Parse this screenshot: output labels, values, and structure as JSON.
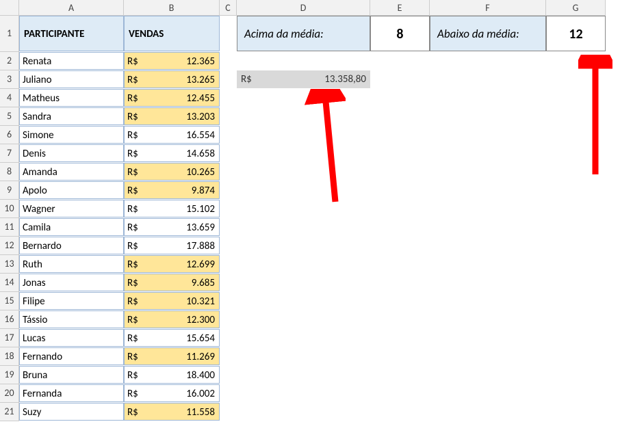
{
  "columns": [
    "A",
    "B",
    "C",
    "D",
    "E",
    "F",
    "G"
  ],
  "rowCount": 21,
  "headers": {
    "participante": "PARTICIPANTE",
    "vendas": "VENDAS"
  },
  "currencyPrefix": "R$",
  "data": [
    {
      "name": "Renata",
      "value": "12.365",
      "highlight": true
    },
    {
      "name": "Juliano",
      "value": "13.265",
      "highlight": true
    },
    {
      "name": "Matheus",
      "value": "12.455",
      "highlight": true
    },
    {
      "name": "Sandra",
      "value": "13.203",
      "highlight": true
    },
    {
      "name": "Simone",
      "value": "16.554",
      "highlight": false
    },
    {
      "name": "Denis",
      "value": "14.658",
      "highlight": false
    },
    {
      "name": "Amanda",
      "value": "10.265",
      "highlight": true
    },
    {
      "name": "Apolo",
      "value": "9.874",
      "highlight": true
    },
    {
      "name": "Wagner",
      "value": "15.102",
      "highlight": false
    },
    {
      "name": "Camila",
      "value": "13.659",
      "highlight": false
    },
    {
      "name": "Bernardo",
      "value": "17.888",
      "highlight": false
    },
    {
      "name": "Ruth",
      "value": "12.699",
      "highlight": true
    },
    {
      "name": "Jonas",
      "value": "9.685",
      "highlight": true
    },
    {
      "name": "Filipe",
      "value": "10.321",
      "highlight": true
    },
    {
      "name": "Tássio",
      "value": "12.300",
      "highlight": true
    },
    {
      "name": "Lucas",
      "value": "15.654",
      "highlight": false
    },
    {
      "name": "Fernando",
      "value": "11.269",
      "highlight": true
    },
    {
      "name": "Bruna",
      "value": "18.400",
      "highlight": false
    },
    {
      "name": "Fernanda",
      "value": "16.002",
      "highlight": false
    },
    {
      "name": "Suzy",
      "value": "11.558",
      "highlight": true
    }
  ],
  "summary": {
    "aboveLabel": "Acima da média:",
    "aboveValue": "8",
    "belowLabel": "Abaixo da média:",
    "belowValue": "12",
    "avgValue": "13.358,80"
  },
  "arrowColor": "#ff0000"
}
